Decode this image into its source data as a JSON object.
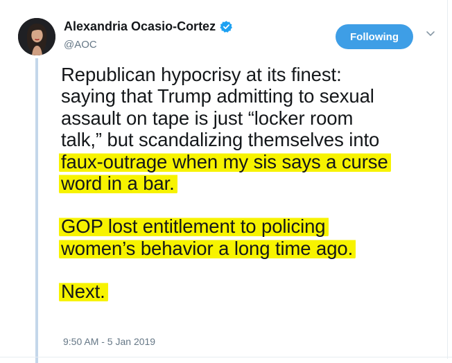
{
  "author": {
    "display_name": "Alexandria Ocasio-Cortez",
    "handle": "@AOC",
    "verified": true,
    "avatar_icon": "profile-photo"
  },
  "actions": {
    "follow_label": "Following",
    "menu_icon": "chevron-down-icon",
    "accent_color": "#3e9ee6"
  },
  "tweet": {
    "paragraphs": [
      {
        "lines": [
          {
            "text": "Republican hypocrisy at its finest:",
            "highlighted": false
          },
          {
            "text": "saying that Trump admitting to sexual",
            "highlighted": false
          },
          {
            "text": "assault on tape is just “locker room",
            "highlighted": false
          },
          {
            "text": "talk,” but scandalizing themselves into",
            "highlighted": false
          },
          {
            "text": "faux-outrage when my sis says a curse",
            "highlighted": true
          },
          {
            "text": "word in a bar.",
            "highlighted": true
          }
        ]
      },
      {
        "lines": [
          {
            "text": "GOP lost entitlement to policing",
            "highlighted": true
          },
          {
            "text": "women’s behavior a long time ago.",
            "highlighted": true
          }
        ]
      },
      {
        "lines": [
          {
            "text": "Next.",
            "highlighted": true
          }
        ]
      }
    ],
    "highlight_color": "#f7f300",
    "timestamp": "9:50 AM - 5 Jan 2019"
  }
}
